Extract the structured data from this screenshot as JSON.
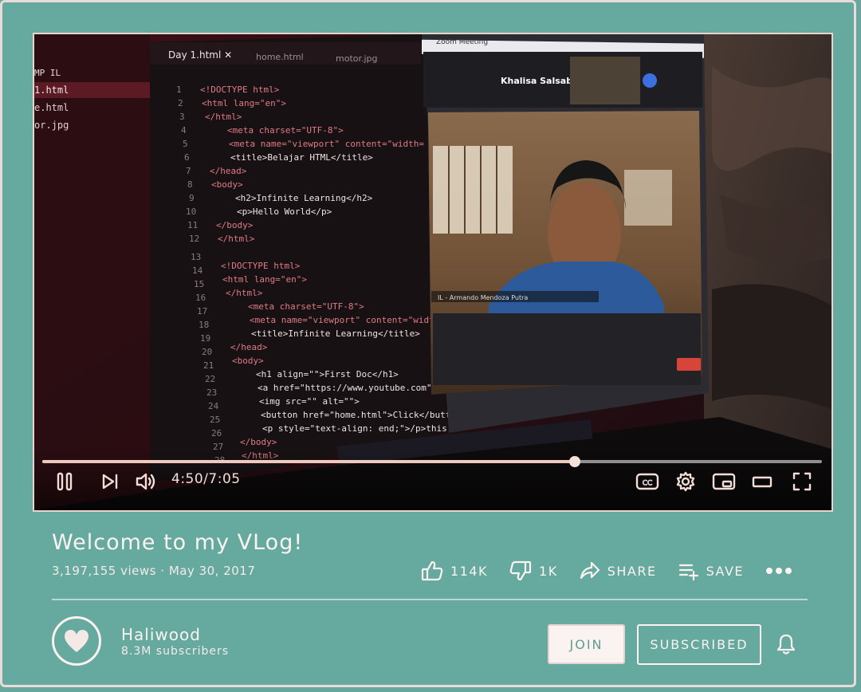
{
  "video": {
    "title": "Welcome to my VLog!",
    "views": "3,197,155 views",
    "separator": "·",
    "date": "May 30, 2017",
    "progress_fraction": 0.683,
    "time_display": "4:50/7:05",
    "thumbnail_description_icon": "video-frame"
  },
  "controls": {
    "pause_icon": "pause-icon",
    "next_icon": "next-icon",
    "volume_icon": "volume-icon",
    "captions_icon": "captions-icon",
    "captions_label": "CC",
    "settings_icon": "gear-icon",
    "miniplayer_icon": "miniplayer-icon",
    "theater_icon": "theater-icon",
    "fullscreen_icon": "fullscreen-icon"
  },
  "actions": {
    "like_count": "114K",
    "dislike_count": "1K",
    "share_label": "SHARE",
    "save_label": "SAVE",
    "more_icon": "more-icon"
  },
  "channel": {
    "name": "Haliwood",
    "subscribers": "8.3M subscribers",
    "avatar_icon": "heart-icon",
    "join_label": "JOIN",
    "subscribed_label": "SUBSCRIBED",
    "bell_icon": "bell-icon"
  },
  "colors": {
    "background": "#67a89e",
    "accent": "#efc9bd",
    "text": "#fbf3ef"
  }
}
